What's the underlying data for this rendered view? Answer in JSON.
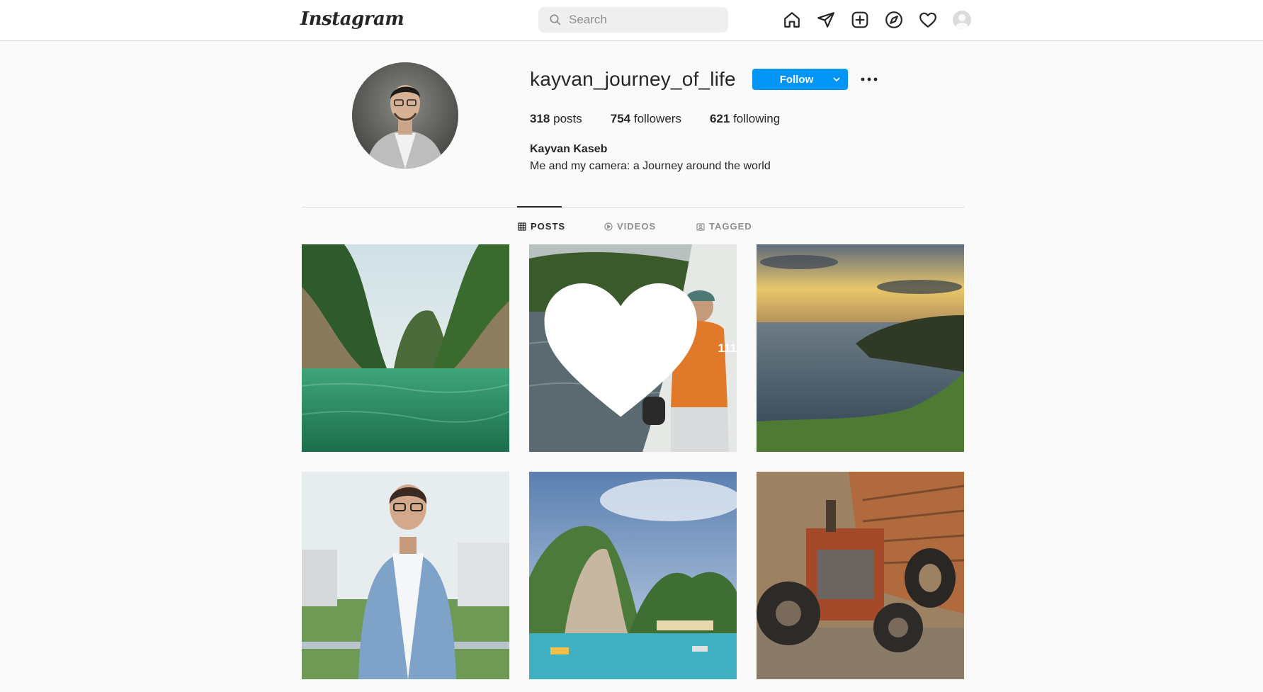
{
  "nav": {
    "logo": "Instagram",
    "search_placeholder": "Search",
    "icons": [
      "home-icon",
      "direct-message-icon",
      "new-post-icon",
      "explore-icon",
      "activity-heart-icon",
      "profile-avatar-icon"
    ]
  },
  "profile": {
    "username": "kayvan_journey_of_life",
    "follow_label": "Follow",
    "posts_count": "318",
    "posts_label": "posts",
    "followers_count": "754",
    "followers_label": "followers",
    "following_count": "621",
    "following_label": "following",
    "full_name": "Kayvan Kaseb",
    "bio": "Me and my camera: a Journey around the world"
  },
  "tabs": [
    {
      "label": "POSTS",
      "icon": "grid-icon",
      "active": true
    },
    {
      "label": "VIDEOS",
      "icon": "play-icon",
      "active": false
    },
    {
      "label": "TAGGED",
      "icon": "tagged-icon",
      "active": false
    }
  ],
  "posts": [
    {
      "subject": "limestone cliffs over green lagoon"
    },
    {
      "subject": "man in life jacket on boat",
      "likes": "111"
    },
    {
      "subject": "sunset over sea and headland"
    },
    {
      "subject": "man in blue blazer portrait"
    },
    {
      "subject": "tropical island mountains with boats"
    },
    {
      "subject": "old red tractor by stone wall"
    }
  ],
  "colors": {
    "accent": "#0095f6",
    "text": "#262626",
    "muted": "#8e8e8e",
    "border": "#dbdbdb",
    "background": "#fafafa"
  }
}
